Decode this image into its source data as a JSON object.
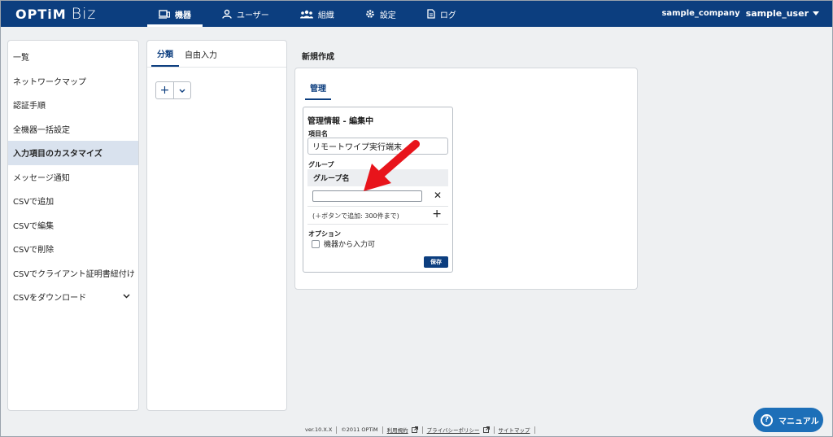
{
  "header": {
    "logo_primary": "OPTiM",
    "logo_secondary": "Biz",
    "nav": [
      {
        "label": "機器",
        "icon": "device-icon",
        "active": true
      },
      {
        "label": "ユーザー",
        "icon": "user-icon",
        "active": false
      },
      {
        "label": "組織",
        "icon": "organization-icon",
        "active": false
      },
      {
        "label": "設定",
        "icon": "gear-icon",
        "active": false
      },
      {
        "label": "ログ",
        "icon": "log-icon",
        "active": false
      }
    ],
    "company": "sample_company",
    "user": "sample_user"
  },
  "sidebar": {
    "items": [
      {
        "label": "一覧"
      },
      {
        "label": "ネットワークマップ"
      },
      {
        "label": "認証手順"
      },
      {
        "label": "全機器一括設定"
      },
      {
        "label": "入力項目のカスタマイズ",
        "active": true
      },
      {
        "label": "メッセージ通知"
      },
      {
        "label": "CSVで追加"
      },
      {
        "label": "CSVで編集"
      },
      {
        "label": "CSVで削除"
      },
      {
        "label": "CSVでクライアント証明書紐付け"
      },
      {
        "label": "CSVをダウンロード",
        "expandable": true
      }
    ]
  },
  "middle": {
    "tabs": [
      {
        "label": "分類",
        "active": true
      },
      {
        "label": "自由入力",
        "active": false
      }
    ],
    "add_button": "+"
  },
  "main": {
    "title": "新規作成",
    "tab": "管理",
    "card": {
      "title": "管理情報 - 編集中",
      "item_name_label": "項目名",
      "item_name_value": "リモートワイプ実行端末",
      "group_label": "グループ",
      "group_header": "グループ名",
      "group_input_value": "",
      "add_hint": "(＋ボタンで追加: 300件まで)",
      "option_label": "オプション",
      "option_checkbox": "機器から入力可",
      "option_checked": false,
      "save_label": "保存"
    }
  },
  "footer": {
    "version": "ver.10.X.X",
    "copyright": "©2011 OPTiM",
    "terms": "利用規約",
    "privacy": "プライバシーポリシー",
    "sitemap": "サイトマップ"
  },
  "manual_button": "マニュアル",
  "colors": {
    "brand": "#0c3e7f",
    "annotation_arrow": "#e8141b",
    "manual_button": "#1d6fb8"
  }
}
